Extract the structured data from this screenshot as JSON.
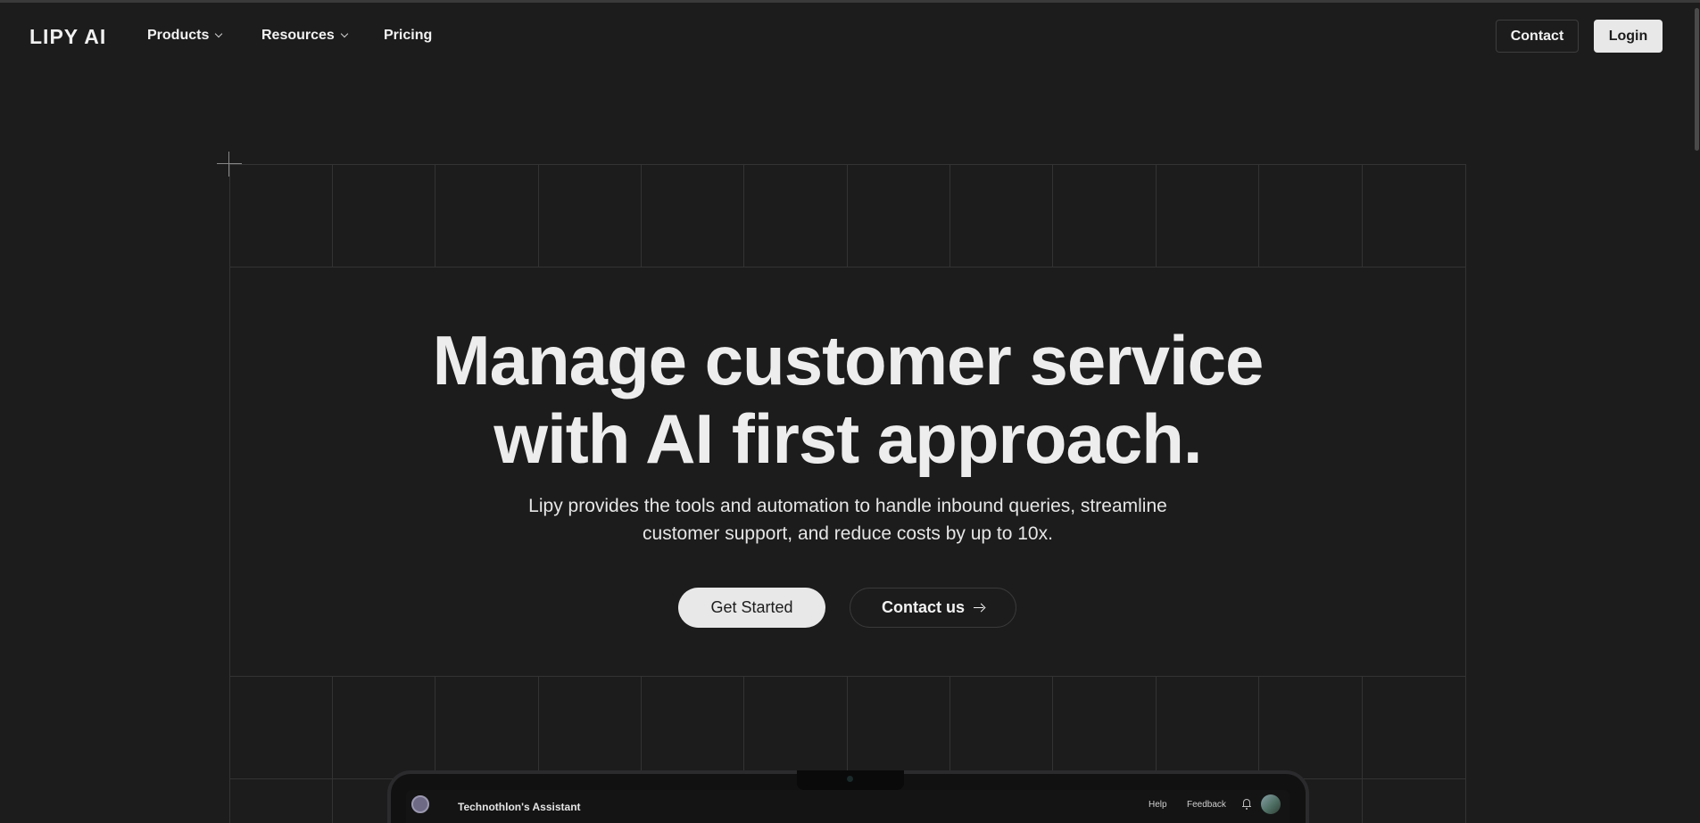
{
  "nav": {
    "logo": "LIPY AI",
    "items": [
      {
        "label": "Products",
        "has_dropdown": true
      },
      {
        "label": "Resources",
        "has_dropdown": true
      },
      {
        "label": "Pricing",
        "has_dropdown": false
      }
    ],
    "contact_label": "Contact",
    "login_label": "Login"
  },
  "hero": {
    "headline_line1": "Manage customer service",
    "headline_line2": "with AI first approach.",
    "subtext_line1": "Lipy provides the tools and automation to handle inbound queries, streamline",
    "subtext_line2": "customer support, and reduce costs by up to 10x.",
    "cta_primary": "Get Started",
    "cta_secondary": "Contact us"
  },
  "preview": {
    "assistant_name": "Technothlon's Assistant",
    "help_label": "Help",
    "feedback_label": "Feedback"
  },
  "colors": {
    "background": "#1c1c1c",
    "text": "#ededed",
    "button_light": "#e8e8e8",
    "grid_line": "#333333"
  },
  "icons": [
    "chevron-down-icon",
    "arrow-right-icon",
    "bell-icon"
  ]
}
